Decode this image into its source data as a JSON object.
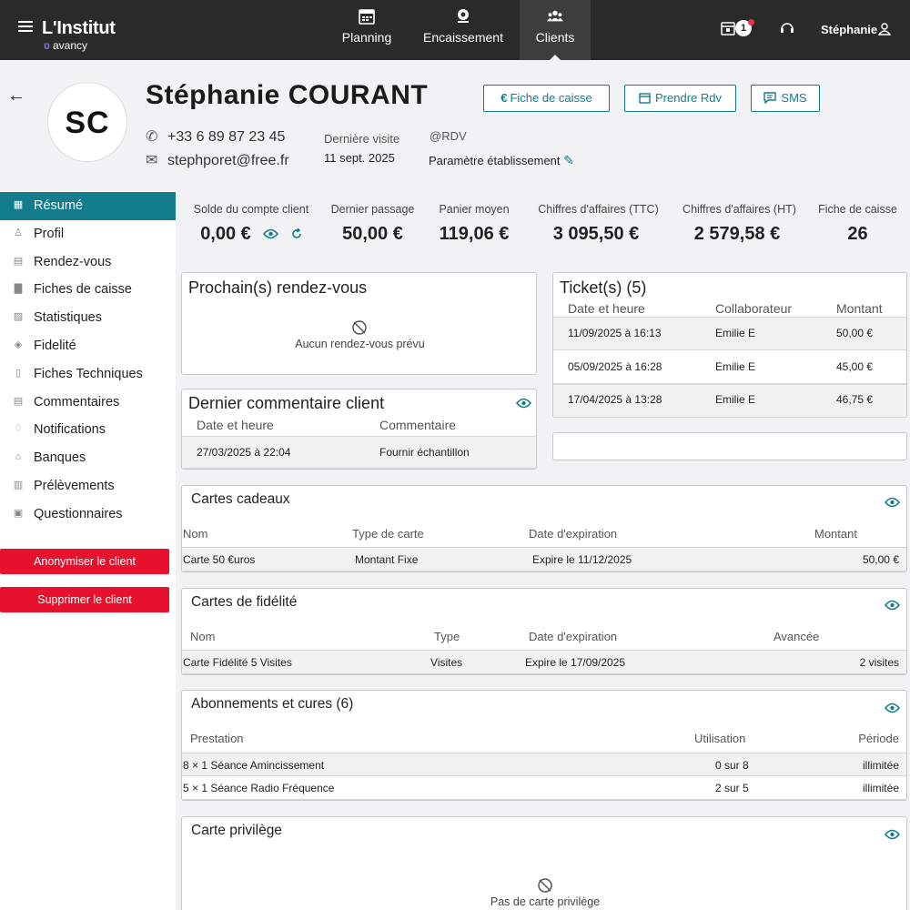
{
  "app": {
    "logo": "L'Institut",
    "logo_sub": "avancy",
    "nav": [
      {
        "label": "Planning",
        "icon": "calendar-icon"
      },
      {
        "label": "Encaissement",
        "icon": "register-icon"
      },
      {
        "label": "Clients",
        "icon": "clients-icon"
      }
    ],
    "notification_count": "1",
    "user": "Stéphanie"
  },
  "client": {
    "initials": "SC",
    "name": "Stéphanie COURANT",
    "phone": "+33 6 89 87 23 45",
    "email": "stephporet@free.fr",
    "last_visit_label": "Dernière visite",
    "last_visit_value": "11 sept. 2025",
    "rdv_label": "@RDV",
    "settings_label": "Paramètre établissement"
  },
  "actions": {
    "fiche_caisse": "Fiche de caisse",
    "prendre_rdv": "Prendre Rdv",
    "sms": "SMS"
  },
  "sidebar": {
    "items": [
      {
        "label": "Résumé",
        "icon": "grid-icon"
      },
      {
        "label": "Profil",
        "icon": "person-icon"
      },
      {
        "label": "Rendez-vous",
        "icon": "calendar-icon"
      },
      {
        "label": "Fiches de caisse",
        "icon": "receipt-icon"
      },
      {
        "label": "Statistiques",
        "icon": "chart-icon"
      },
      {
        "label": "Fidelité",
        "icon": "tag-icon"
      },
      {
        "label": "Fiches Techniques",
        "icon": "document-icon"
      },
      {
        "label": "Commentaires",
        "icon": "comment-icon"
      },
      {
        "label": "Notifications",
        "icon": "bell-icon"
      },
      {
        "label": "Banques",
        "icon": "bank-icon"
      },
      {
        "label": "Prélèvements",
        "icon": "transfer-icon"
      },
      {
        "label": "Questionnaires",
        "icon": "form-icon"
      }
    ],
    "anonymize": "Anonymiser le client",
    "delete": "Supprimer le client"
  },
  "stats": [
    {
      "label": "Solde du compte client",
      "value": "0,00 €"
    },
    {
      "label": "Dernier passage",
      "value": "50,00 €"
    },
    {
      "label": "Panier moyen",
      "value": "119,06 €"
    },
    {
      "label": "Chiffres d'affaires (TTC)",
      "value": "3 095,50 €"
    },
    {
      "label": "Chiffres d'affaires (HT)",
      "value": "2 579,58 €"
    },
    {
      "label": "Fiche de caisse",
      "value": "26"
    }
  ],
  "prochains_rdv": {
    "title": "Prochain(s) rendez-vous",
    "empty": "Aucun rendez-vous prévu"
  },
  "tickets": {
    "title": "Ticket(s) (5)",
    "headers": [
      "Date et heure",
      "Collaborateur",
      "Montant"
    ],
    "rows": [
      [
        "11/09/2025 à 16:13",
        "Emilie E",
        "50,00 €"
      ],
      [
        "05/09/2025 à 16:28",
        "Emilie E",
        "45,00 €"
      ],
      [
        "17/04/2025 à 13:28",
        "Emilie E",
        "46,75 €"
      ]
    ]
  },
  "commentaire": {
    "title": "Dernier commentaire client",
    "headers": [
      "Date et heure",
      "Commentaire"
    ],
    "rows": [
      [
        "27/03/2025 à 22:04",
        "Fournir échantillon"
      ]
    ]
  },
  "cartes_cadeaux": {
    "title": "Cartes cadeaux",
    "headers": [
      "Nom",
      "Type de carte",
      "Date d'expiration",
      "Montant"
    ],
    "rows": [
      [
        "Carte 50 €uros",
        "Montant Fixe",
        "Expire le 11/12/2025",
        "50,00 €"
      ]
    ]
  },
  "cartes_fidelite": {
    "title": "Cartes de fidélité",
    "headers": [
      "Nom",
      "Type",
      "Date d'expiration",
      "Avancée"
    ],
    "rows": [
      [
        "Carte Fidélité 5 Visites",
        "Visites",
        "Expire le 17/09/2025",
        "2 visites"
      ]
    ]
  },
  "abonnements": {
    "title": "Abonnements et cures (6)",
    "headers": [
      "Prestation",
      "Utilisation",
      "Période"
    ],
    "rows": [
      [
        "8 × 1 Séance Amincissement",
        "0 sur 8",
        "illimitée"
      ],
      [
        "5 × 1 Séance Radio Fréquence",
        "2 sur 5",
        "illimitée"
      ]
    ]
  },
  "carte_privilege": {
    "title": "Carte privilège",
    "empty": "Pas de carte privilège"
  },
  "colors": {
    "accent": "#137c8c",
    "danger": "#e8112d",
    "topbar": "#2a2a2a"
  }
}
